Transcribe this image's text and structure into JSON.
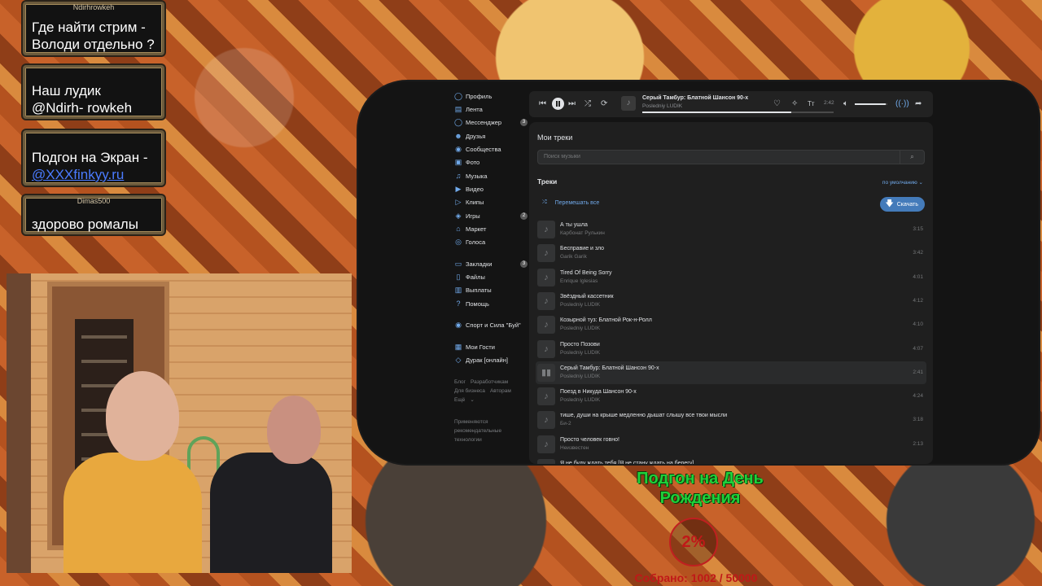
{
  "chat": [
    {
      "author": "Ndirhrowkeh",
      "text": "Где найти стрим - Володи отдельно ?"
    },
    {
      "author": "",
      "text": "Наш лудик @Ndirh- rowkeh"
    },
    {
      "author": "",
      "text": "Подгон на Экран -",
      "link": "@XXXfinkyy.ru"
    },
    {
      "author": "Dimas500",
      "text": "здорово ромалы"
    }
  ],
  "sidebar": {
    "items": [
      {
        "label": "Профиль",
        "icon": "user-icon"
      },
      {
        "label": "Лента",
        "icon": "feed-icon"
      },
      {
        "label": "Мессенджер",
        "icon": "messenger-icon",
        "badge": "3"
      },
      {
        "label": "Друзья",
        "icon": "friends-icon"
      },
      {
        "label": "Сообщества",
        "icon": "communities-icon"
      },
      {
        "label": "Фото",
        "icon": "photo-icon"
      },
      {
        "label": "Музыка",
        "icon": "music-icon"
      },
      {
        "label": "Видео",
        "icon": "video-icon"
      },
      {
        "label": "Клипы",
        "icon": "clips-icon"
      },
      {
        "label": "Игры",
        "icon": "games-icon",
        "badge": "2"
      },
      {
        "label": "Маркет",
        "icon": "market-icon"
      },
      {
        "label": "Голоса",
        "icon": "votes-icon"
      },
      {
        "label": "Закладки",
        "icon": "bookmarks-icon",
        "badge": "3"
      },
      {
        "label": "Файлы",
        "icon": "files-icon"
      },
      {
        "label": "Выплаты",
        "icon": "payouts-icon"
      },
      {
        "label": "Помощь",
        "icon": "help-icon"
      },
      {
        "label": "Спорт и Сила \"Буй\"",
        "icon": "community-icon"
      },
      {
        "label": "Мои Гости",
        "icon": "app-icon"
      },
      {
        "label": "Дурак [онлайн]",
        "icon": "game-icon"
      }
    ],
    "footer": {
      "links_row1": [
        "Блог",
        "Разработчикам"
      ],
      "links_row2": [
        "Для бизнеса",
        "Авторам"
      ],
      "more": "Ещё",
      "tech_note": "Применяются рекомендательные технологии"
    }
  },
  "player": {
    "title": "Серый Тамбур: Блатной Шансон 90-х",
    "artist": "Posledniy LUDIK",
    "time": "2:42",
    "progress": 0.78,
    "volume": 0.95
  },
  "music": {
    "section_title": "Мои треки",
    "search_placeholder": "Поиск музыки",
    "tracks_title": "Треки",
    "sort_label": "по умолчанию",
    "shuffle_label": "Перемешать все",
    "download_label": "Скачать",
    "tracks": [
      {
        "title": "А ты ушла",
        "artist": "Карбонат Рулькин",
        "duration": "3:15"
      },
      {
        "title": "Бесправие и зло",
        "artist": "Garik Garik",
        "duration": "3:42"
      },
      {
        "title": "Tired Of Being Sorry",
        "artist": "Enrique Iglesias",
        "duration": "4:01"
      },
      {
        "title": "Звёздный кассетник",
        "artist": "Posledniy LUDIK",
        "duration": "4:12"
      },
      {
        "title": "Козырной туз: Блатной Рок-н-Ролл",
        "artist": "Posledniy LUDIK",
        "duration": "4:10"
      },
      {
        "title": "Просто Позови",
        "artist": "Posledniy LUDIK",
        "duration": "4:07"
      },
      {
        "title": "Серый Тамбур: Блатной Шансон 90-х",
        "artist": "Posledniy LUDIK",
        "duration": "2:41",
        "active": true
      },
      {
        "title": "Поезд в Никуда Шансон 90-х",
        "artist": "Posledniy LUDIK",
        "duration": "4:24"
      },
      {
        "title": "тише, души на крыше медленно дышат слышу все твои мысли",
        "artist": "Би-2",
        "duration": "3:18"
      },
      {
        "title": "Просто человек говно!",
        "artist": "Неизвестен",
        "duration": "2:13"
      },
      {
        "title": "Я не буду ждать тебя [Я не стану ждать на берегу]",
        "artist": "",
        "duration": ""
      }
    ]
  },
  "donation": {
    "title": "Подгон на День Рождения",
    "percent": "2%",
    "collected": "Собрано: 1002 / 50000"
  }
}
